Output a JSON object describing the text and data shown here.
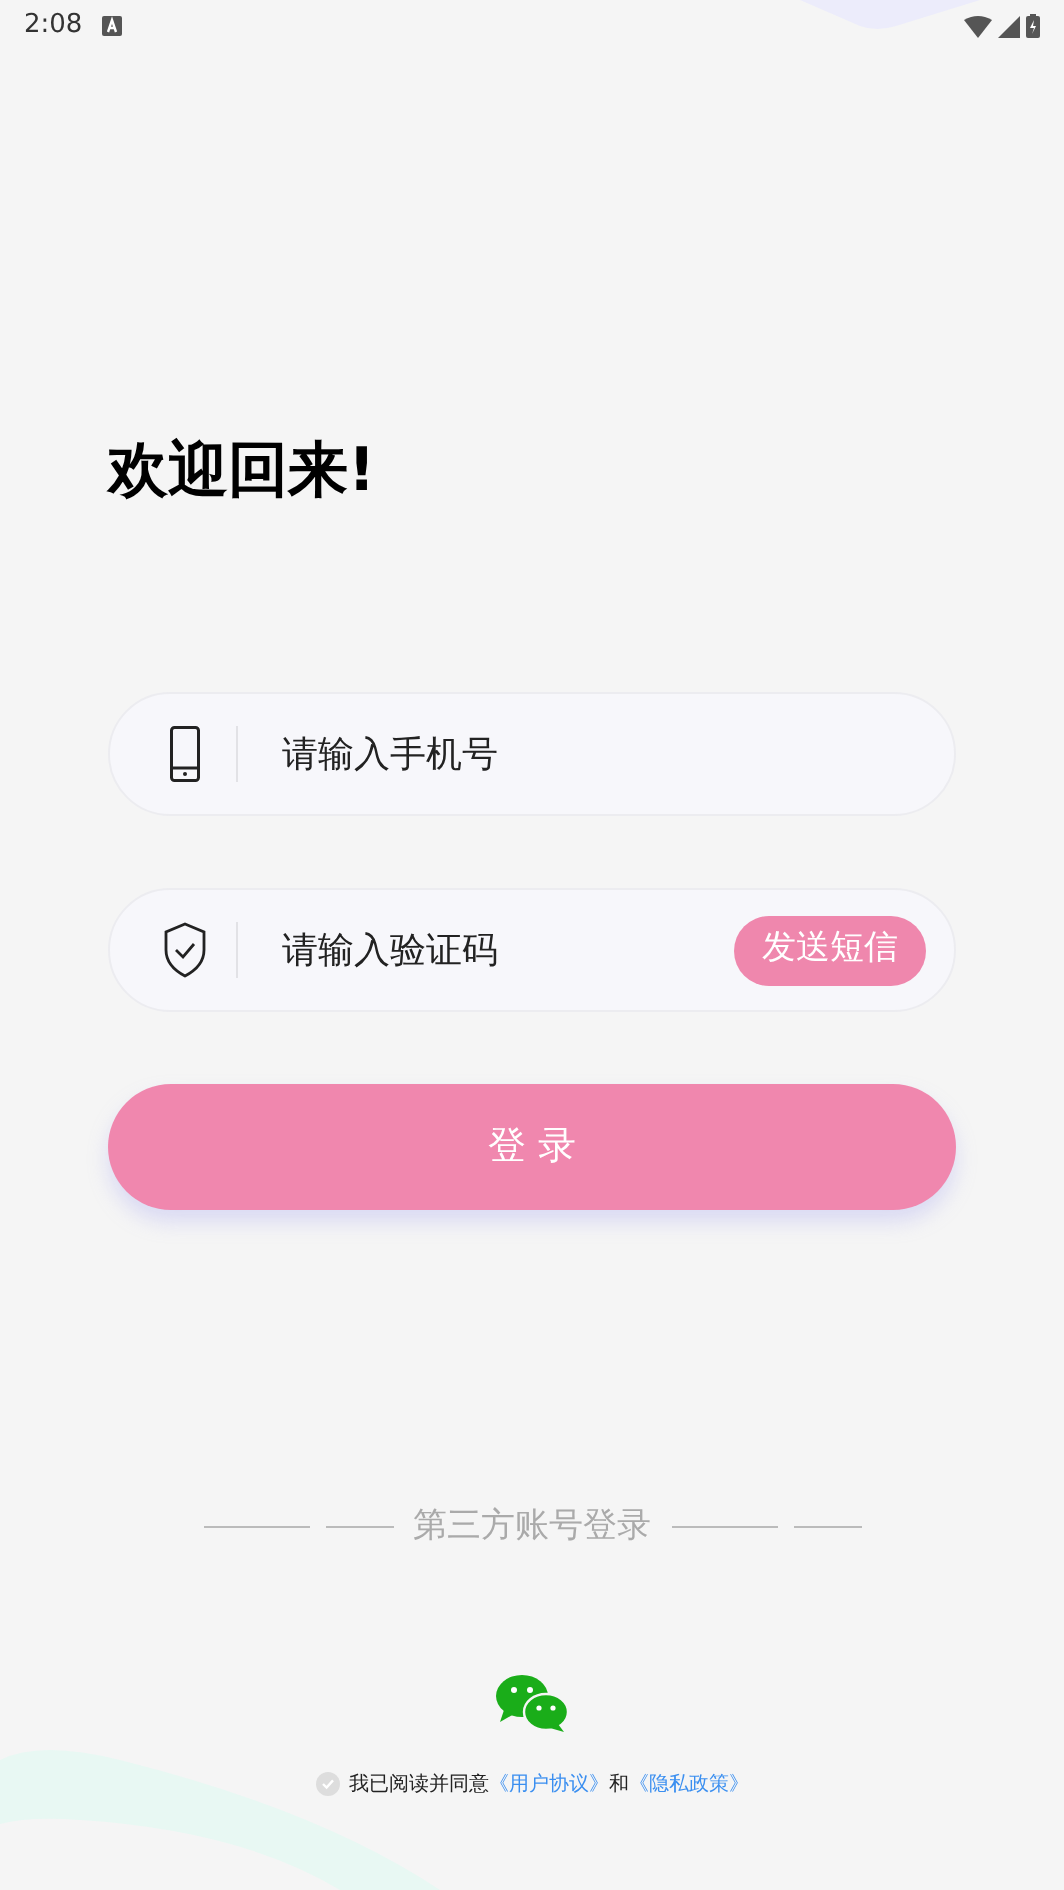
{
  "status_bar": {
    "time": "2:08"
  },
  "title": "欢迎回来!",
  "phone_field": {
    "placeholder": "请输入手机号"
  },
  "code_field": {
    "placeholder": "请输入验证码",
    "send_button": "发送短信"
  },
  "login_button": "登 录",
  "third_party": {
    "label": "第三方账号登录"
  },
  "agreement": {
    "checked": false,
    "text": "我已阅读并同意",
    "link_1": "《用户协议》",
    "conjunction": "和",
    "link_2": "《隐私政策》"
  }
}
